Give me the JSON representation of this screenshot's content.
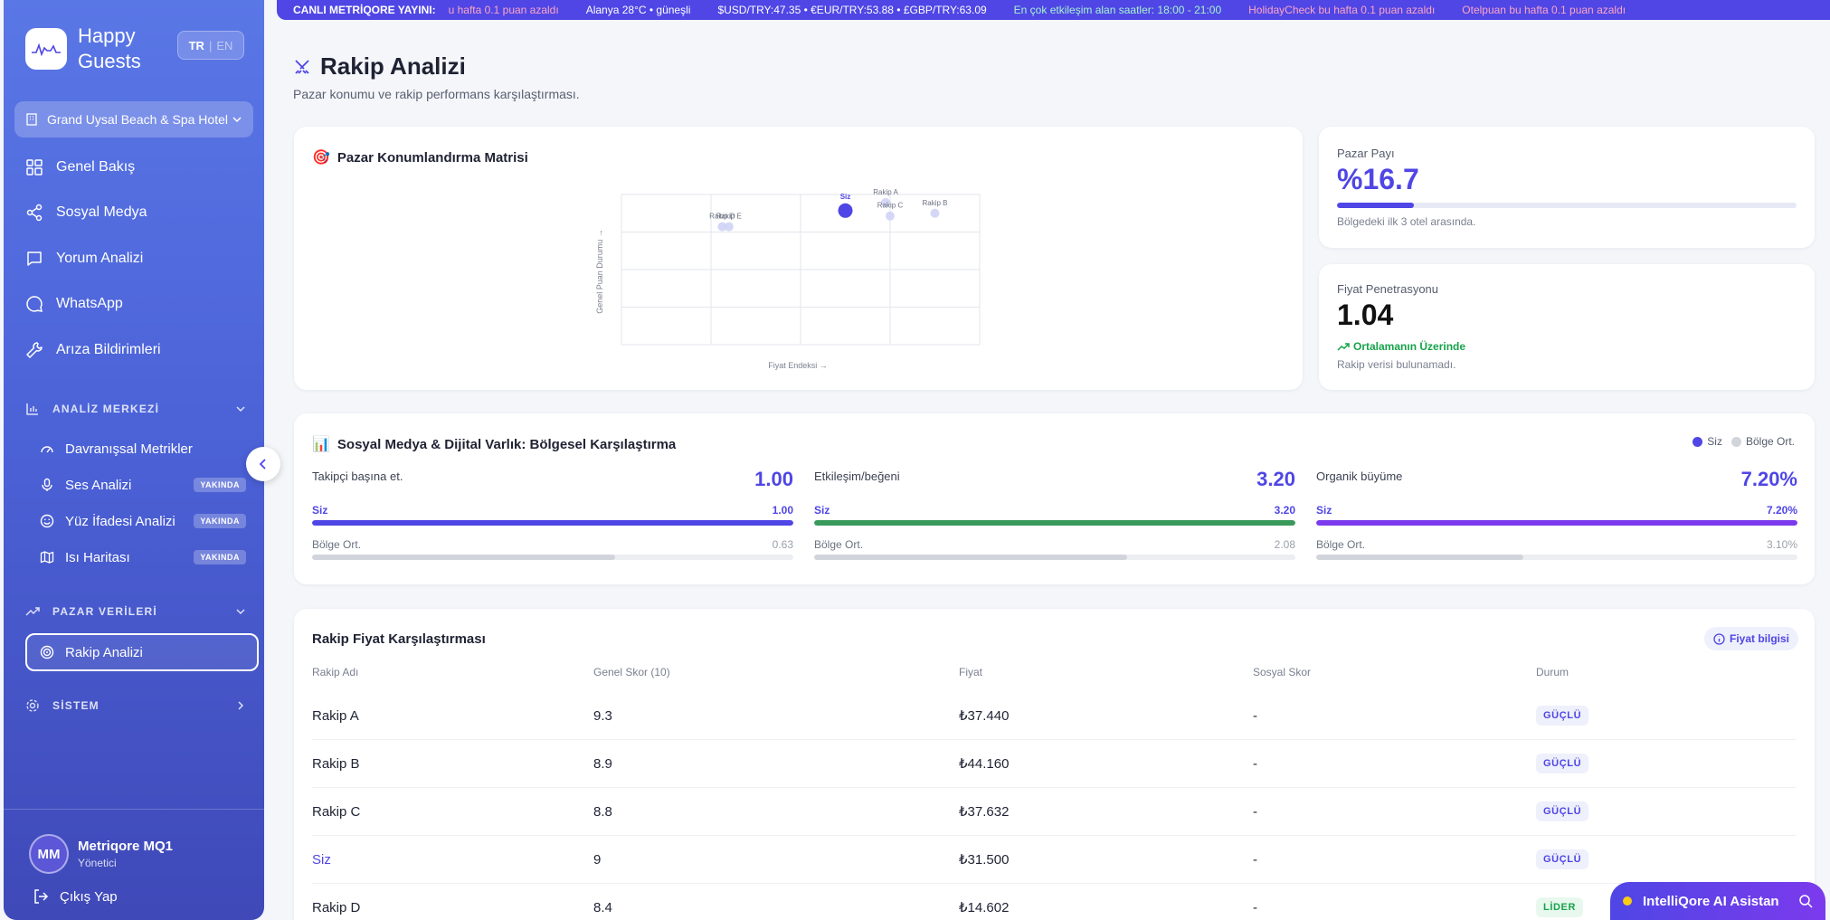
{
  "brand": {
    "name": "Happy Guests",
    "lang_active": "TR",
    "lang_other": "EN"
  },
  "hotel": {
    "name": "Grand Uysal Beach & Spa Hotel"
  },
  "nav": [
    {
      "label": "Genel Bakış",
      "icon": "grid-icon"
    },
    {
      "label": "Sosyal Medya",
      "icon": "share-icon"
    },
    {
      "label": "Yorum Analizi",
      "icon": "message-icon"
    },
    {
      "label": "WhatsApp",
      "icon": "chat-bubble-icon"
    },
    {
      "label": "Arıza Bildirimleri",
      "icon": "wrench-icon"
    }
  ],
  "sections": {
    "analysis": {
      "title": "ANALİZ MERKEZİ",
      "items": [
        {
          "label": "Davranışsal Metrikler",
          "badge": ""
        },
        {
          "label": "Ses Analizi",
          "badge": "YAKINDA"
        },
        {
          "label": "Yüz İfadesi Analizi",
          "badge": "YAKINDA"
        },
        {
          "label": "Isı Haritası",
          "badge": "YAKINDA"
        }
      ]
    },
    "market": {
      "title": "PAZAR VERİLERİ",
      "active_item": "Rakip Analizi"
    },
    "system": {
      "title": "SİSTEM"
    }
  },
  "user": {
    "initials": "MM",
    "name": "Metriqore MQ1",
    "role": "Yönetici",
    "logout": "Çıkış Yap"
  },
  "ticker": {
    "live": "CANLI METRİQORE YAYINI:",
    "items": [
      "u hafta 0.1 puan azaldı",
      "Alanya 28°C • güneşli",
      "$USD/TRY:47.35 • €EUR/TRY:53.88 • £GBP/TRY:63.09",
      "En çok etkileşim alan saatler: 18:00 - 21:00",
      "HolidayCheck bu hafta 0.1 puan azaldı",
      "Otelpuan bu hafta 0.1 puan azaldı"
    ]
  },
  "page": {
    "title": "Rakip Analizi",
    "subtitle": "Pazar konumu ve rakip performans karşılaştırması."
  },
  "matrix": {
    "title": "Pazar Konumlandırma Matrisi",
    "x_label": "Fiyat Endeksi →",
    "y_label": "Genel Puan Durumu →"
  },
  "chart_data": {
    "type": "scatter",
    "title": "Pazar Konumlandırma Matrisi",
    "xlabel": "Fiyat Endeksi →",
    "ylabel": "Genel Puan Durumu →",
    "grid": true,
    "points": [
      {
        "label": "Rakip D",
        "x": 0.45,
        "y": 8.4
      },
      {
        "label": "Rakip E",
        "x": 0.48,
        "y": 8.4
      },
      {
        "label": "Siz",
        "x": 1.0,
        "y": 9.0,
        "highlight": true
      },
      {
        "label": "Rakip A",
        "x": 1.18,
        "y": 9.3
      },
      {
        "label": "Rakip C",
        "x": 1.2,
        "y": 8.8
      },
      {
        "label": "Rakip B",
        "x": 1.4,
        "y": 8.9
      }
    ]
  },
  "market_share": {
    "label": "Pazar Payı",
    "value": "%16.7",
    "progress": 0.167,
    "note": "Bölgedeki ilk 3 otel arasında."
  },
  "price_pen": {
    "label": "Fiyat Penetrasyonu",
    "value": "1.04",
    "trend": "Ortalamanın Üzerinde",
    "note": "Rakip verisi bulunamadı."
  },
  "social": {
    "title": "Sosyal Medya & Dijital Varlık: Bölgesel Karşılaştırma",
    "legend_you": "Siz",
    "legend_avg": "Bölge Ort.",
    "you_label": "Siz",
    "avg_label": "Bölge Ort.",
    "metrics": [
      {
        "name": "Takipçi başına et.",
        "big": "1.00",
        "you": "1.00",
        "avg": "0.63",
        "you_frac": 1.0,
        "avg_frac": 0.63,
        "color": "#4f46e5"
      },
      {
        "name": "Etkileşim/beğeni",
        "big": "3.20",
        "you": "3.20",
        "avg": "2.08",
        "you_frac": 1.0,
        "avg_frac": 0.65,
        "color": "#3a9a5b"
      },
      {
        "name": "Organik büyüme",
        "big": "7.20%",
        "you": "7.20%",
        "avg": "3.10%",
        "you_frac": 1.0,
        "avg_frac": 0.43,
        "color": "#7c3aed"
      }
    ]
  },
  "price_table": {
    "title": "Rakip Fiyat Karşılaştırması",
    "info": "Fiyat bilgisi",
    "headers": [
      "Rakip Adı",
      "Genel Skor (10)",
      "Fiyat",
      "Sosyal Skor",
      "Durum"
    ],
    "rows": [
      {
        "name": "Rakip A",
        "score": "9.3",
        "price": "₺37.440",
        "social": "-",
        "status": "GÜÇLÜ",
        "kind": "strong"
      },
      {
        "name": "Rakip B",
        "score": "8.9",
        "price": "₺44.160",
        "social": "-",
        "status": "GÜÇLÜ",
        "kind": "strong"
      },
      {
        "name": "Rakip C",
        "score": "8.8",
        "price": "₺37.632",
        "social": "-",
        "status": "GÜÇLÜ",
        "kind": "strong"
      },
      {
        "name": "Siz",
        "score": "9",
        "price": "₺31.500",
        "social": "-",
        "status": "GÜÇLÜ",
        "kind": "strong",
        "you": true
      },
      {
        "name": "Rakip D",
        "score": "8.4",
        "price": "₺14.602",
        "social": "-",
        "status": "LİDER",
        "kind": "leader"
      }
    ]
  },
  "assistant": {
    "label": "IntelliQore AI Asistan"
  }
}
